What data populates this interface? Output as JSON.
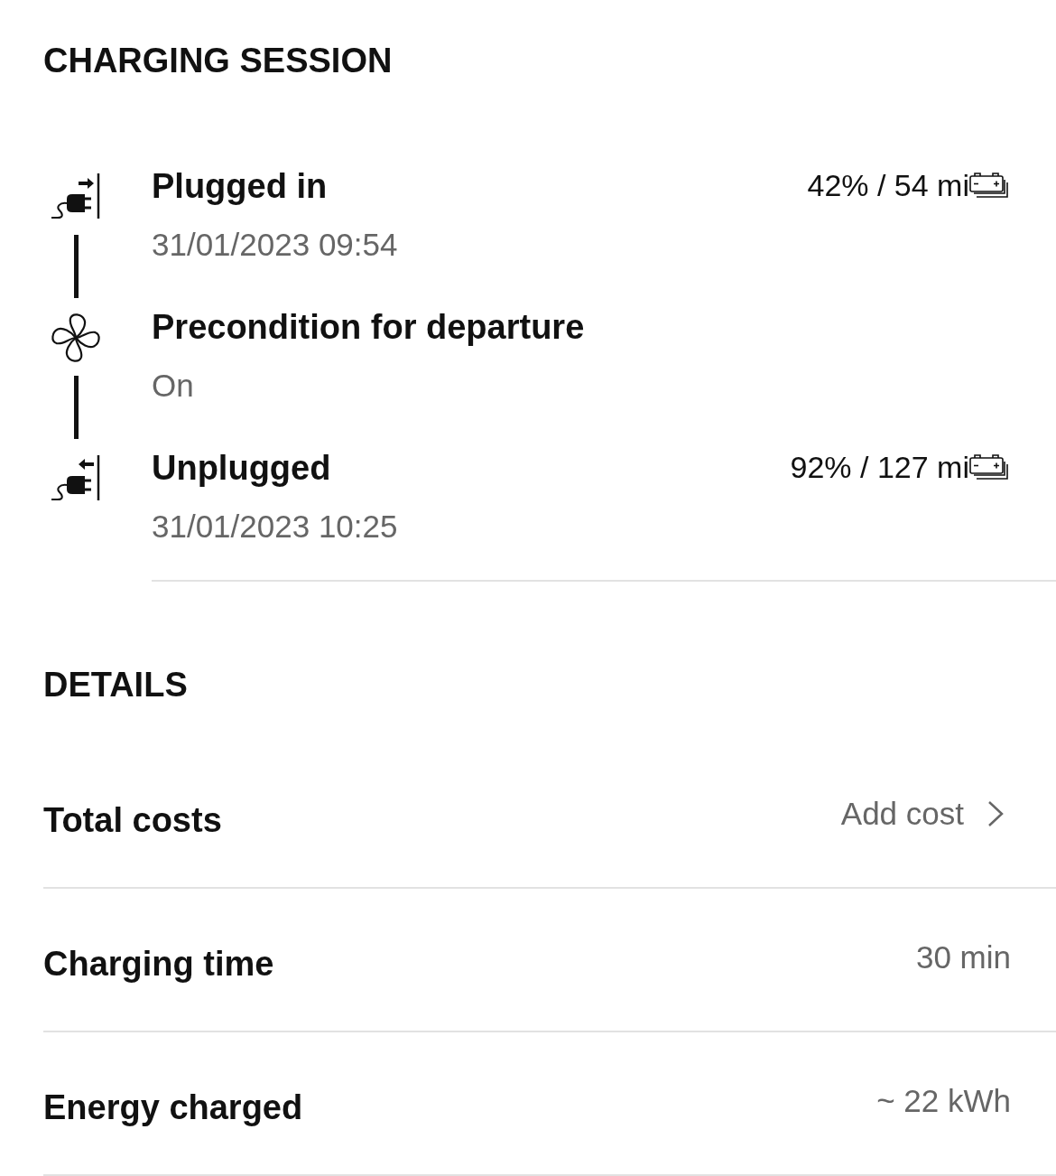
{
  "title": "CHARGING SESSION",
  "timeline": [
    {
      "kind": "plug-in",
      "title": "Plugged in",
      "subtitle": "31/01/2023 09:54",
      "reading": "42% / 54 mi"
    },
    {
      "kind": "fan",
      "title": "Precondition for departure",
      "subtitle": "On"
    },
    {
      "kind": "unplug",
      "title": "Unplugged",
      "subtitle": "31/01/2023 10:25",
      "reading": "92% / 127 mi"
    }
  ],
  "details": {
    "title": "DETAILS",
    "rows": [
      {
        "kind": "link",
        "label": "Total costs",
        "value": "Add cost"
      },
      {
        "kind": "value",
        "label": "Charging time",
        "value": "30 min"
      },
      {
        "kind": "value",
        "label": "Energy charged",
        "value": "~ 22 kWh"
      }
    ]
  }
}
